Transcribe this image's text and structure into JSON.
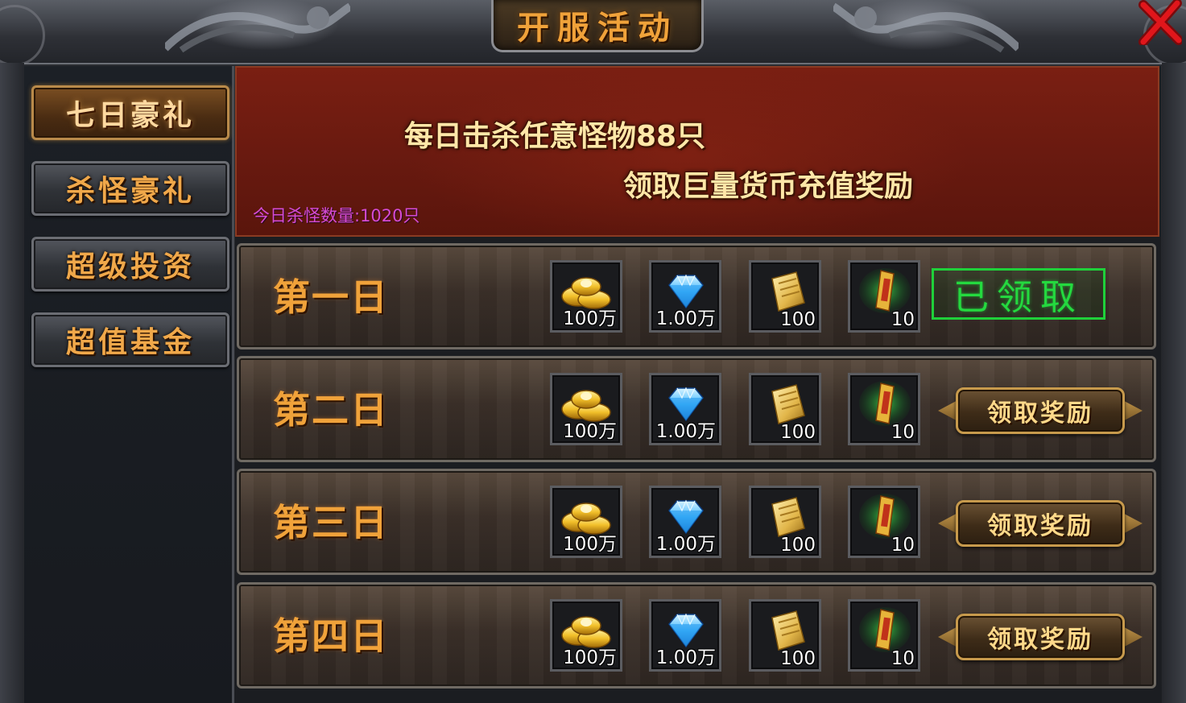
{
  "window": {
    "title": "开服活动"
  },
  "sidebar": {
    "items": [
      {
        "label": "七日豪礼",
        "active": true
      },
      {
        "label": "杀怪豪礼",
        "active": false
      },
      {
        "label": "超级投资",
        "active": false
      },
      {
        "label": "超值基金",
        "active": false
      }
    ]
  },
  "banner": {
    "line1": "每日击杀任意怪物88只",
    "line2": "领取巨量货币充值奖励",
    "kill_count": "今日杀怪数量:1020只"
  },
  "days": [
    {
      "label": "第一日",
      "rewards": [
        {
          "icon": "gold-ingot-icon",
          "qty": "100万"
        },
        {
          "icon": "diamond-icon",
          "qty": "1.00万"
        },
        {
          "icon": "scroll-icon",
          "qty": "100"
        },
        {
          "icon": "talisman-icon",
          "qty": "10"
        }
      ],
      "status": "claimed",
      "status_text": "已领取"
    },
    {
      "label": "第二日",
      "rewards": [
        {
          "icon": "gold-ingot-icon",
          "qty": "100万"
        },
        {
          "icon": "diamond-icon",
          "qty": "1.00万"
        },
        {
          "icon": "scroll-icon",
          "qty": "100"
        },
        {
          "icon": "talisman-icon",
          "qty": "10"
        }
      ],
      "status": "available",
      "status_text": "领取奖励"
    },
    {
      "label": "第三日",
      "rewards": [
        {
          "icon": "gold-ingot-icon",
          "qty": "100万"
        },
        {
          "icon": "diamond-icon",
          "qty": "1.00万"
        },
        {
          "icon": "scroll-icon",
          "qty": "100"
        },
        {
          "icon": "talisman-icon",
          "qty": "10"
        }
      ],
      "status": "available",
      "status_text": "领取奖励"
    },
    {
      "label": "第四日",
      "rewards": [
        {
          "icon": "gold-ingot-icon",
          "qty": "100万"
        },
        {
          "icon": "diamond-icon",
          "qty": "1.00万"
        },
        {
          "icon": "scroll-icon",
          "qty": "100"
        },
        {
          "icon": "talisman-icon",
          "qty": "10"
        }
      ],
      "status": "available",
      "status_text": "领取奖励"
    }
  ],
  "colors": {
    "title_gold": "#f0a23a",
    "banner_red": "#6a1a10",
    "kill_count_magenta": "#d54bd3",
    "claimed_green": "#24d93f",
    "close_red": "#e0161b"
  }
}
